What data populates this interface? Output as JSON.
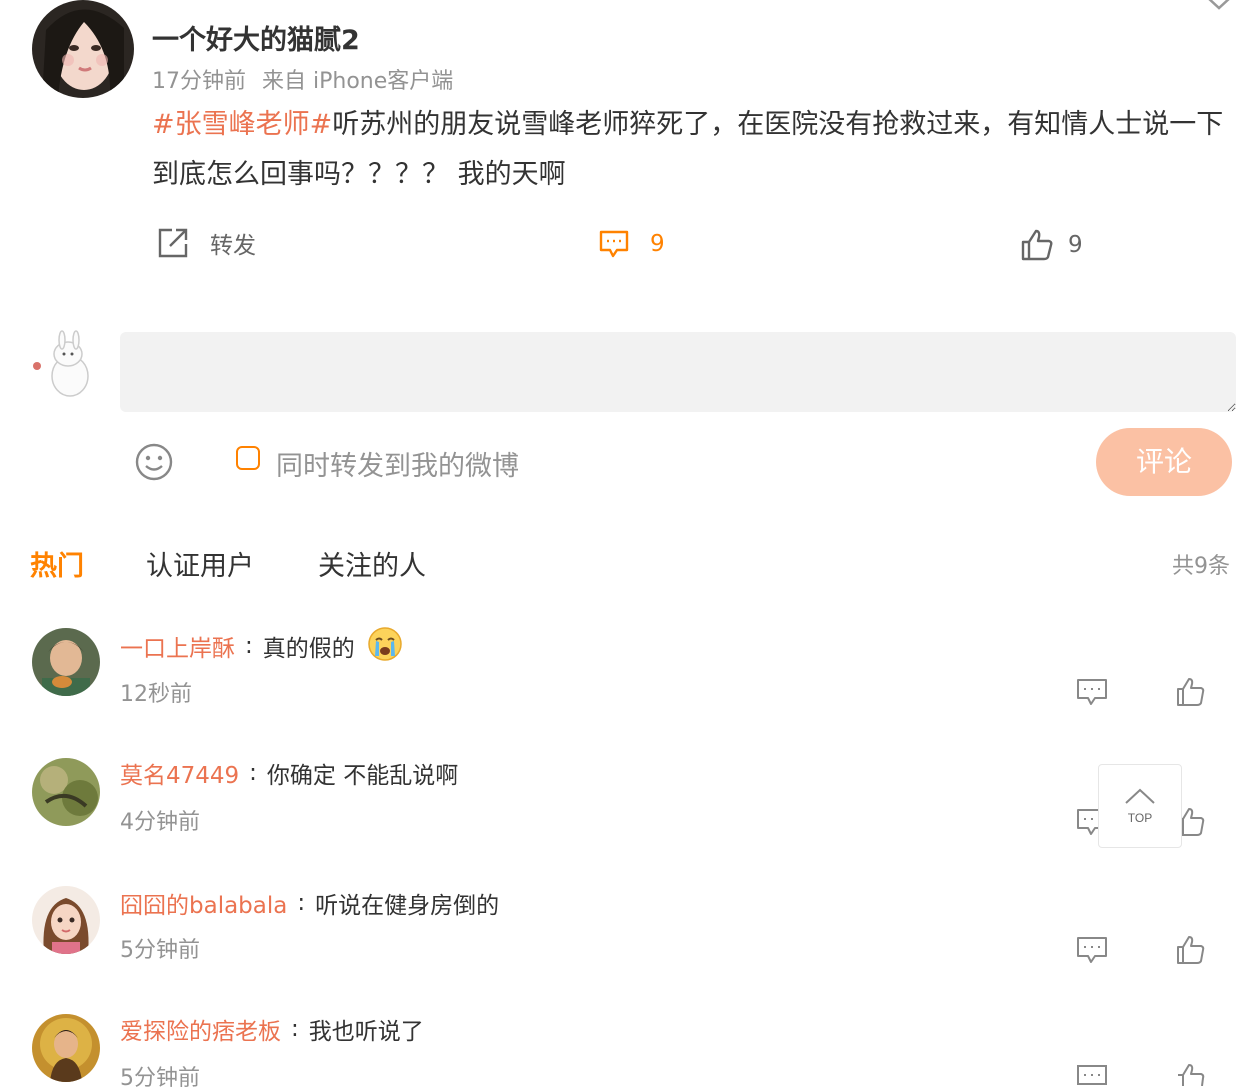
{
  "post": {
    "username": "一个好大的猫腻2",
    "time": "17分钟前",
    "source": "来自 iPhone客户端",
    "topic": "#张雪峰老师#",
    "text": "听苏州的朋友说雪峰老师猝死了，在医院没有抢救过来，有知情人士说一下到底怎么回事吗？？？？ 我的天啊",
    "repost_label": "转发",
    "comment_count": "9",
    "like_count": "9"
  },
  "composer": {
    "repost_checkbox_label": "同时转发到我的微博",
    "submit_label": "评论"
  },
  "tabs": [
    {
      "label": "热门",
      "active": true
    },
    {
      "label": "认证用户",
      "active": false
    },
    {
      "label": "关注的人",
      "active": false
    }
  ],
  "total_label": "共9条",
  "comments": [
    {
      "user": "一口上岸酥",
      "text": "真的假的",
      "time": "12秒前",
      "emoji": "crying-face"
    },
    {
      "user": "莫名47449",
      "text": "你确定 不能乱说啊",
      "time": "4分钟前"
    },
    {
      "user": "囧囧的balabala",
      "text": "听说在健身房倒的",
      "time": "5分钟前"
    },
    {
      "user": "爱探险的痞老板",
      "text": "我也听说了",
      "time": "5分钟前"
    }
  ],
  "top_button_label": "TOP",
  "colors": {
    "accent": "#ff8200",
    "link": "#eb7350",
    "muted": "#939393",
    "submit_disabled": "#fbc1a4"
  }
}
